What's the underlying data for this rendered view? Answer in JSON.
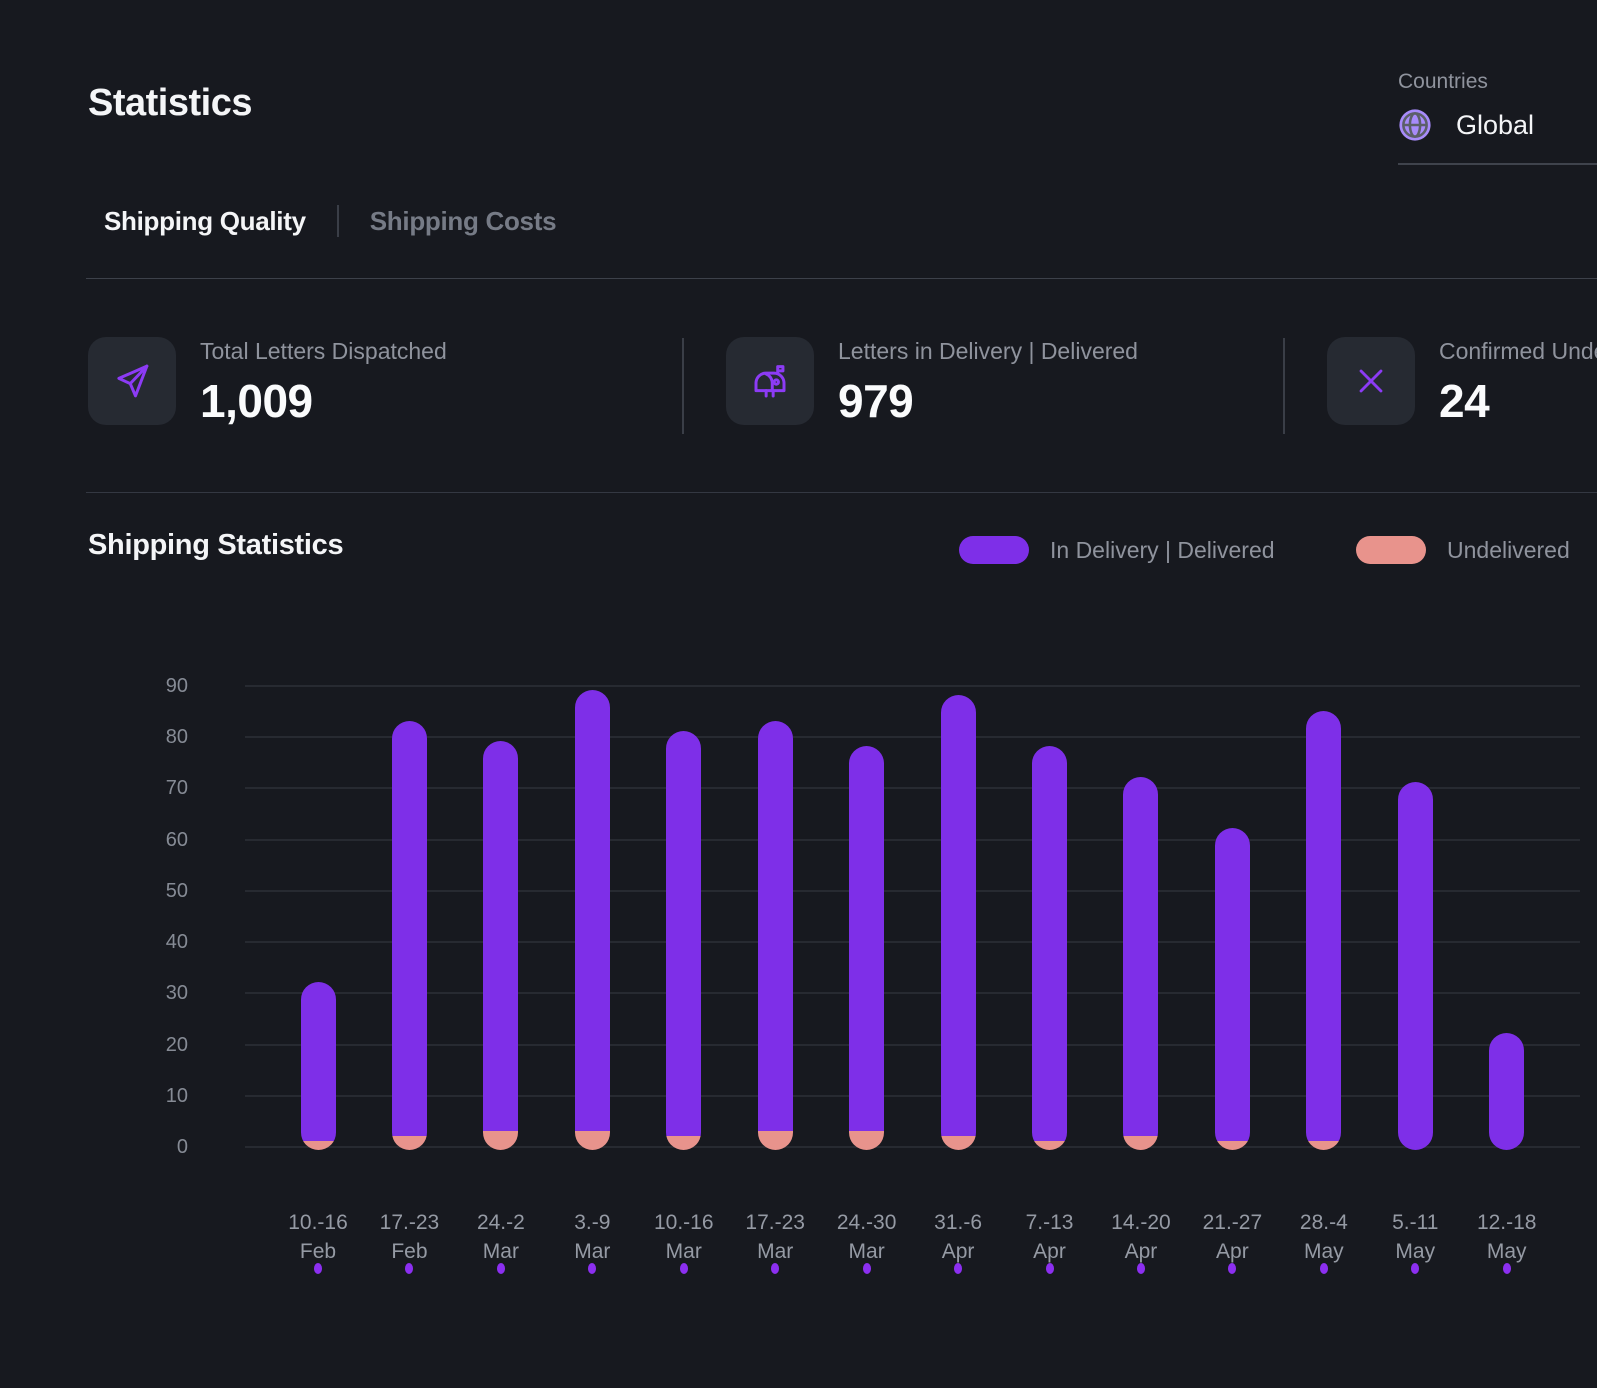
{
  "header": {
    "title": "Statistics",
    "countries_label": "Countries",
    "country_value": "Global"
  },
  "tabs": [
    {
      "label": "Shipping Quality",
      "active": true
    },
    {
      "label": "Shipping Costs",
      "active": false
    }
  ],
  "stat_cards": [
    {
      "icon": "send-icon",
      "label": "Total Letters Dispatched",
      "value": "1,009"
    },
    {
      "icon": "mailbox-icon",
      "label": "Letters in Delivery | Delivered",
      "value": "979"
    },
    {
      "icon": "x-icon",
      "label": "Confirmed Undelivered",
      "value": "24"
    }
  ],
  "section": {
    "title": "Shipping Statistics"
  },
  "legend": [
    {
      "label": "In Delivery | Delivered",
      "color": "#7e2fe8"
    },
    {
      "label": "Undelivered",
      "color": "#e8938c"
    }
  ],
  "colors": {
    "background": "#17191f",
    "accent_purple": "#7e2fe8",
    "salmon": "#e8938c",
    "globe_purple": "#a78bfa",
    "text_gray": "#8f939d"
  },
  "chart_data": {
    "type": "bar",
    "stacked": true,
    "title": "Shipping Statistics",
    "xlabel": "",
    "ylabel": "",
    "ylim": [
      0,
      90
    ],
    "y_ticks": [
      0,
      10,
      20,
      30,
      40,
      50,
      60,
      70,
      80,
      90
    ],
    "grid": true,
    "legend_position": "top-right",
    "categories": [
      {
        "range": "10.-16",
        "month": "Feb"
      },
      {
        "range": "17.-23",
        "month": "Feb"
      },
      {
        "range": "24.-2",
        "month": "Mar"
      },
      {
        "range": "3.-9",
        "month": "Mar"
      },
      {
        "range": "10.-16",
        "month": "Mar"
      },
      {
        "range": "17.-23",
        "month": "Mar"
      },
      {
        "range": "24.-30",
        "month": "Mar"
      },
      {
        "range": "31.-6",
        "month": "Apr"
      },
      {
        "range": "7.-13",
        "month": "Apr"
      },
      {
        "range": "14.-20",
        "month": "Apr"
      },
      {
        "range": "21.-27",
        "month": "Apr"
      },
      {
        "range": "28.-4",
        "month": "May"
      },
      {
        "range": "5.-11",
        "month": "May"
      },
      {
        "range": "12.-18",
        "month": "May"
      }
    ],
    "series": [
      {
        "name": "In Delivery | Delivered",
        "color": "#7e2fe8",
        "values": [
          31,
          81,
          76,
          86,
          79,
          80,
          75,
          86,
          77,
          70,
          61,
          84,
          71,
          22
        ]
      },
      {
        "name": "Undelivered",
        "color": "#e8938c",
        "values": [
          1,
          2,
          3,
          3,
          2,
          3,
          3,
          2,
          1,
          2,
          1,
          1,
          0,
          0
        ]
      }
    ],
    "totals": [
      32,
      83,
      79,
      89,
      81,
      83,
      78,
      88,
      78,
      72,
      62,
      85,
      71,
      22
    ]
  }
}
